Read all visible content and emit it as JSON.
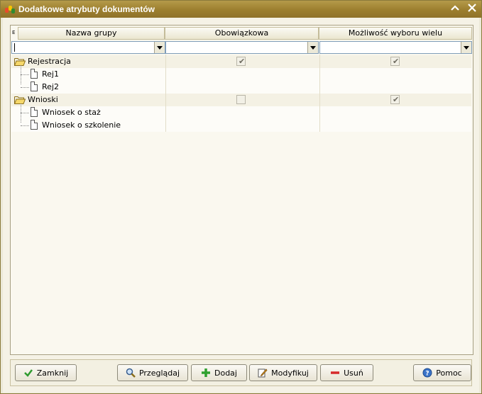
{
  "window": {
    "title": "Dodatkowe atrybuty dokumentów"
  },
  "grid": {
    "corner_marker": "E",
    "columns": [
      "Nazwa grupy",
      "Obowiązkowa",
      "Możliwość wyboru wielu"
    ],
    "rows": [
      {
        "label": "Rejestracja",
        "type": "group",
        "obowiazkowa": true,
        "wiele": true
      },
      {
        "label": "Rej1",
        "type": "item"
      },
      {
        "label": "Rej2",
        "type": "item"
      },
      {
        "label": "Wnioski",
        "type": "group",
        "obowiazkowa": false,
        "wiele": true
      },
      {
        "label": "Wniosek o staż",
        "type": "item"
      },
      {
        "label": "Wniosek o szkolenie",
        "type": "item"
      }
    ]
  },
  "buttons": {
    "close": "Zamknij",
    "browse": "Przeglądaj",
    "add": "Dodaj",
    "modify": "Modyfikuj",
    "delete": "Usuń",
    "help": "Pomoc"
  },
  "icons": {
    "app": "app-icon",
    "minimize": "chevron-up-icon",
    "close": "close-icon",
    "folder": "folder-open-icon",
    "document": "document-icon",
    "check": "checkmark-icon",
    "search": "magnifier-icon",
    "plus": "plus-icon",
    "edit": "edit-icon",
    "minus": "minus-icon",
    "help": "help-icon"
  }
}
